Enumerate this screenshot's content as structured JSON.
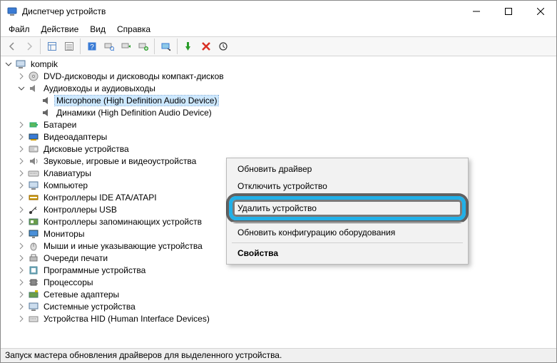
{
  "window": {
    "title": "Диспетчер устройств"
  },
  "menu": {
    "file": "Файл",
    "action": "Действие",
    "view": "Вид",
    "help": "Справка"
  },
  "tree": {
    "root": "kompik",
    "dvd": "DVD-дисководы и дисководы компакт-дисков",
    "audio": "Аудиовходы и аудиовыходы",
    "mic": "Microphone (High Definition Audio Device)",
    "speakers": "Динамики (High Definition Audio Device)",
    "battery": "Батареи",
    "video": "Видеоадаптеры",
    "disk": "Дисковые устройства",
    "sound": "Звуковые, игровые и видеоустройства",
    "keyboard": "Клавиатуры",
    "computer": "Компьютер",
    "ide": "Контроллеры IDE ATA/ATAPI",
    "usb": "Контроллеры USB",
    "storagectl": "Контроллеры запоминающих устройств",
    "monitor": "Мониторы",
    "mouse": "Мыши и иные указывающие устройства",
    "printq": "Очереди печати",
    "soft": "Программные устройства",
    "cpu": "Процессоры",
    "net": "Сетевые адаптеры",
    "sys": "Системные устройства",
    "hid": "Устройства HID (Human Interface Devices)"
  },
  "context": {
    "update": "Обновить драйвер",
    "disable": "Отключить устройство",
    "delete": "Удалить устройство",
    "rescan": "Обновить конфигурацию оборудования",
    "props": "Свойства"
  },
  "status": "Запуск мастера обновления драйверов для выделенного устройства."
}
